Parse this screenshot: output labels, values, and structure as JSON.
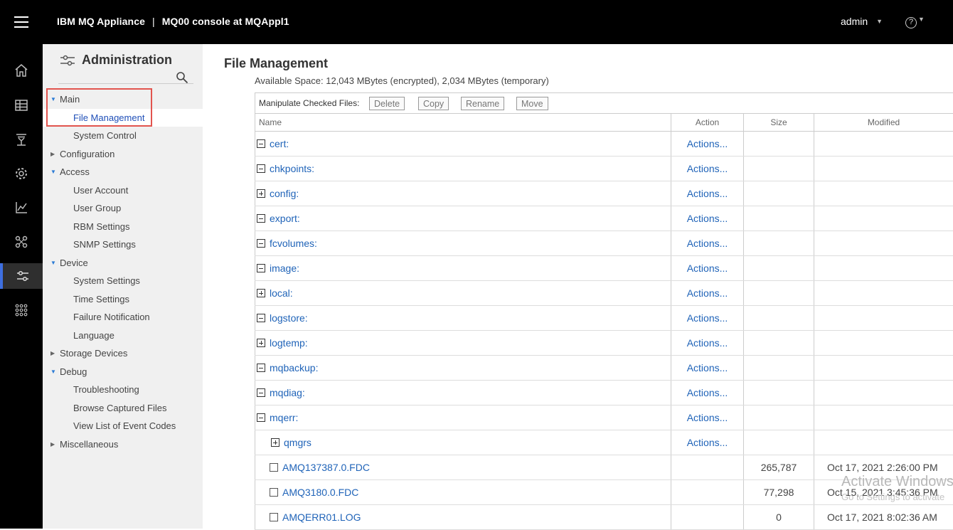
{
  "topbar": {
    "product": "IBM MQ Appliance",
    "separator": "|",
    "console": "MQ00 console at MQAppl1",
    "user": "admin",
    "help_glyph": "?"
  },
  "rail": {
    "icons": [
      "home-icon",
      "table-icon",
      "queue-manager-icon",
      "gear-icon",
      "chart-icon",
      "network-icon",
      "administration-icon",
      "more-icon"
    ],
    "active": "administration-icon",
    "accent": "#3e6fe0"
  },
  "nav": {
    "title": "Administration",
    "items": [
      {
        "label": "Main",
        "level": 1,
        "expanded": true
      },
      {
        "label": "File Management",
        "level": 2,
        "selected": true
      },
      {
        "label": "System Control",
        "level": 2
      },
      {
        "label": "Configuration",
        "level": 1,
        "expanded": false
      },
      {
        "label": "Access",
        "level": 1,
        "expanded": true
      },
      {
        "label": "User Account",
        "level": 2
      },
      {
        "label": "User Group",
        "level": 2
      },
      {
        "label": "RBM Settings",
        "level": 2
      },
      {
        "label": "SNMP Settings",
        "level": 2
      },
      {
        "label": "Device",
        "level": 1,
        "expanded": true
      },
      {
        "label": "System Settings",
        "level": 2
      },
      {
        "label": "Time Settings",
        "level": 2
      },
      {
        "label": "Failure Notification",
        "level": 2
      },
      {
        "label": "Language",
        "level": 2
      },
      {
        "label": "Storage Devices",
        "level": 1,
        "expanded": false
      },
      {
        "label": "Debug",
        "level": 1,
        "expanded": true
      },
      {
        "label": "Troubleshooting",
        "level": 2
      },
      {
        "label": "Browse Captured Files",
        "level": 2
      },
      {
        "label": "View List of Event Codes",
        "level": 2
      },
      {
        "label": "Miscellaneous",
        "level": 1,
        "expanded": false
      }
    ]
  },
  "main": {
    "title": "File Management",
    "available_space": "Available Space: 12,043 MBytes (encrypted), 2,034 MBytes (temporary)",
    "toolbar": {
      "label": "Manipulate Checked Files:",
      "buttons": [
        "Delete",
        "Copy",
        "Rename",
        "Move"
      ]
    },
    "columns": {
      "name": "Name",
      "action": "Action",
      "size": "Size",
      "modified": "Modified"
    },
    "rows": [
      {
        "name": "cert:",
        "kind": "dir",
        "state": "minus",
        "action": "Actions...",
        "size": "",
        "modified": ""
      },
      {
        "name": "chkpoints:",
        "kind": "dir",
        "state": "minus",
        "action": "Actions...",
        "size": "",
        "modified": ""
      },
      {
        "name": "config:",
        "kind": "dir",
        "state": "plus",
        "action": "Actions...",
        "size": "",
        "modified": ""
      },
      {
        "name": "export:",
        "kind": "dir",
        "state": "minus",
        "action": "Actions...",
        "size": "",
        "modified": ""
      },
      {
        "name": "fcvolumes:",
        "kind": "dir",
        "state": "minus",
        "action": "Actions...",
        "size": "",
        "modified": ""
      },
      {
        "name": "image:",
        "kind": "dir",
        "state": "minus",
        "action": "Actions...",
        "size": "",
        "modified": ""
      },
      {
        "name": "local:",
        "kind": "dir",
        "state": "plus",
        "action": "Actions...",
        "size": "",
        "modified": ""
      },
      {
        "name": "logstore:",
        "kind": "dir",
        "state": "minus",
        "action": "Actions...",
        "size": "",
        "modified": ""
      },
      {
        "name": "logtemp:",
        "kind": "dir",
        "state": "plus",
        "action": "Actions...",
        "size": "",
        "modified": ""
      },
      {
        "name": "mqbackup:",
        "kind": "dir",
        "state": "minus",
        "action": "Actions...",
        "size": "",
        "modified": ""
      },
      {
        "name": "mqdiag:",
        "kind": "dir",
        "state": "minus",
        "action": "Actions...",
        "size": "",
        "modified": ""
      },
      {
        "name": "mqerr:",
        "kind": "dir",
        "state": "minus",
        "action": "Actions...",
        "size": "",
        "modified": ""
      },
      {
        "name": "qmgrs",
        "kind": "subdir",
        "state": "plus",
        "action": "Actions...",
        "size": "",
        "modified": ""
      },
      {
        "name": "AMQ137387.0.FDC",
        "kind": "file",
        "action": "",
        "size": "265,787",
        "modified": "Oct 17, 2021 2:26:00 PM"
      },
      {
        "name": "AMQ3180.0.FDC",
        "kind": "file",
        "action": "",
        "size": "77,298",
        "modified": "Oct 15, 2021 3:45:36 PM"
      },
      {
        "name": "AMQERR01.LOG",
        "kind": "file",
        "action": "",
        "size": "0",
        "modified": "Oct 17, 2021 8:02:36 AM"
      }
    ]
  },
  "watermark": {
    "line1": "Activate Windows",
    "line2": "Go to Settings to activate"
  }
}
